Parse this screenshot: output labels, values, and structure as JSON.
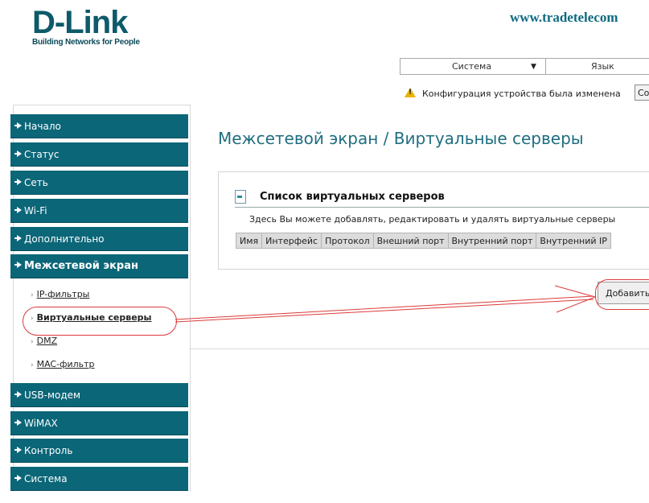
{
  "header": {
    "brand": "D-Link",
    "tagline": "Building Networks for People",
    "site_url": "www.tradetelecom"
  },
  "topmenu": {
    "system_label": "Система",
    "language_label": "Язык"
  },
  "notice": {
    "text": "Конфигурация устройства была изменена",
    "save_label": "Со"
  },
  "sidebar": {
    "items": [
      {
        "label": "Начало"
      },
      {
        "label": "Статус"
      },
      {
        "label": "Сеть"
      },
      {
        "label": "Wi-Fi"
      },
      {
        "label": "Дополнительно"
      },
      {
        "label": "Межсетевой экран"
      },
      {
        "label": "USB-модем"
      },
      {
        "label": "WiMAX"
      },
      {
        "label": "Контроль"
      },
      {
        "label": "Система"
      }
    ],
    "sub_items": [
      {
        "label": "IP-фильтры"
      },
      {
        "label": "Виртуальные серверы"
      },
      {
        "label": "DMZ"
      },
      {
        "label": "MAC-фильтр"
      }
    ]
  },
  "main": {
    "title": "Межсетевой экран  / Виртуальные серверы",
    "panel_title": "Список виртуальных серверов",
    "panel_desc": "Здесь Вы можете добавлять, редактировать и удалять виртуальные серверы",
    "columns": [
      "Имя",
      "Интерфейс",
      "Протокол",
      "Внешний порт",
      "Внутренний порт",
      "Внутренний IP"
    ],
    "add_label": "Добавить"
  },
  "colors": {
    "nav_bg": "#0b6678",
    "title": "#1f6e80",
    "annotation": "#dc3a3a"
  },
  "icons": [
    "warning-icon",
    "nav-arrow-icon",
    "list-icon",
    "chevron-down-icon"
  ]
}
